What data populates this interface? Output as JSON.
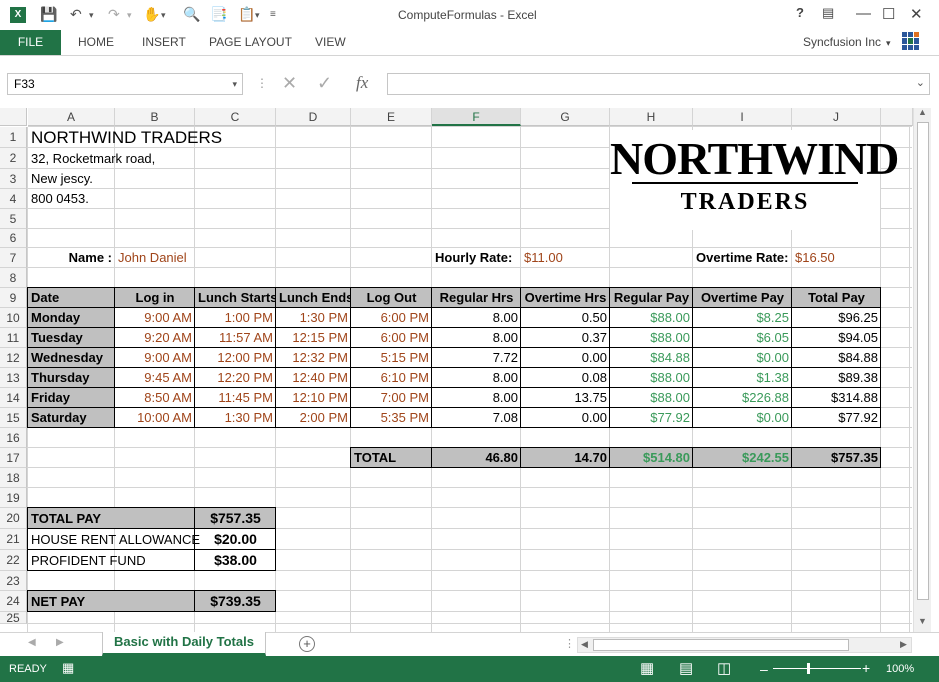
{
  "window": {
    "title": "ComputeFormulas - Excel",
    "help": "?",
    "account": "Syncfusion Inc"
  },
  "ribbon": {
    "tabs": [
      "FILE",
      "HOME",
      "INSERT",
      "PAGE LAYOUT",
      "VIEW"
    ]
  },
  "formula_bar": {
    "name_box": "F33",
    "fx": "fx",
    "value": ""
  },
  "columns": [
    "A",
    "B",
    "C",
    "D",
    "E",
    "F",
    "G",
    "H",
    "I",
    "J"
  ],
  "rows": [
    "1",
    "2",
    "3",
    "4",
    "5",
    "6",
    "7",
    "8",
    "9",
    "10",
    "11",
    "12",
    "13",
    "14",
    "15",
    "16",
    "17",
    "18",
    "19",
    "20",
    "21",
    "22",
    "23",
    "24",
    "25"
  ],
  "sheet": {
    "company": "NORTHWIND TRADERS",
    "address1": "32, Rocketmark road,",
    "address2": "New jescy.",
    "phone": "800 0453.",
    "logo_line1": "NORTHWIND",
    "logo_line2": "TRADERS",
    "name_label": "Name :",
    "name_value": "John Daniel",
    "hourly_label": "Hourly Rate:",
    "hourly_value": "$11.00",
    "overtime_label": "Overtime Rate:",
    "overtime_value": "$16.50",
    "headers": [
      "Date",
      "Log in",
      "Lunch Starts",
      "Lunch Ends",
      "Log Out",
      "Regular Hrs",
      "Overtime Hrs",
      "Regular Pay",
      "Overtime Pay",
      "Total Pay"
    ],
    "days": [
      [
        "Monday",
        "9:00 AM",
        "1:00 PM",
        "1:30 PM",
        "6:00 PM",
        "8.00",
        "0.50",
        "$88.00",
        "$8.25",
        "$96.25"
      ],
      [
        "Tuesday",
        "9:20 AM",
        "11:57 AM",
        "12:15 PM",
        "6:00 PM",
        "8.00",
        "0.37",
        "$88.00",
        "$6.05",
        "$94.05"
      ],
      [
        "Wednesday",
        "9:00 AM",
        "12:00 PM",
        "12:32 PM",
        "5:15 PM",
        "7.72",
        "0.00",
        "$84.88",
        "$0.00",
        "$84.88"
      ],
      [
        "Thursday",
        "9:45 AM",
        "12:20 PM",
        "12:40 PM",
        "6:10 PM",
        "8.00",
        "0.08",
        "$88.00",
        "$1.38",
        "$89.38"
      ],
      [
        "Friday",
        "8:50 AM",
        "11:45 PM",
        "12:10 PM",
        "7:00 PM",
        "8.00",
        "13.75",
        "$88.00",
        "$226.88",
        "$314.88"
      ],
      [
        "Saturday",
        "10:00 AM",
        "1:30 PM",
        "2:00 PM",
        "5:35 PM",
        "7.08",
        "0.00",
        "$77.92",
        "$0.00",
        "$77.92"
      ]
    ],
    "total": [
      "TOTAL",
      "46.80",
      "14.70",
      "$514.80",
      "$242.55",
      "$757.35"
    ],
    "summary": [
      [
        "TOTAL PAY",
        "$757.35"
      ],
      [
        "HOUSE RENT ALLOWANCE",
        "$20.00"
      ],
      [
        "PROFIDENT FUND",
        "$38.00"
      ]
    ],
    "net": [
      "NET PAY",
      "$739.35"
    ]
  },
  "tabs": {
    "active": "Basic with Daily Totals"
  },
  "status": {
    "ready": "READY",
    "zoom": "100%"
  },
  "colors": {
    "excel_green": "#217346",
    "input_brown": "#a0451a",
    "pay_green": "#3a9a5a",
    "header_gray": "#c0c0c0"
  }
}
